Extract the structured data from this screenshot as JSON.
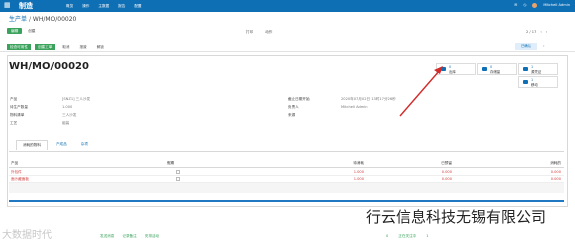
{
  "topbar": {
    "apps_icon": "apps-grid-icon",
    "app_title": "制造",
    "menu": [
      "概览",
      "操作",
      "主数据",
      "报告",
      "配置"
    ],
    "right": {
      "user": "Mitchell Admin"
    }
  },
  "breadcrumb": {
    "root": "生产单",
    "sep": "/",
    "current": "WH/MO/00020"
  },
  "control": {
    "edit": "编辑",
    "create": "创建",
    "print": "打印",
    "action": "动作",
    "pager": "2 / 17"
  },
  "actions": {
    "check_availability": "检查可用性",
    "create_workorder": "创建工单",
    "cancel": "取消",
    "scrap": "报废",
    "unreserve": "解锁"
  },
  "steps": [
    "已确认"
  ],
  "record": {
    "title": "WH/MO/00020"
  },
  "smart_buttons": [
    {
      "num": "0",
      "label": "出库",
      "icon": "truck-icon"
    },
    {
      "num": "0",
      "label": "存储量",
      "icon": "cart-icon"
    },
    {
      "num": "1",
      "label": "源凭证",
      "icon": "truck-icon"
    },
    {
      "num": "1",
      "label": "移动",
      "icon": "truck-icon"
    }
  ],
  "left_fields": [
    {
      "label": "产品",
      "value": "[SNZ1] 三人沙发"
    },
    {
      "label": "待生产数量",
      "value": "1.000"
    },
    {
      "label": "物料清单",
      "value": "三人沙发"
    },
    {
      "label": "工艺",
      "value": "组装"
    }
  ],
  "right_fields": [
    {
      "label": "截止日期开始",
      "value": "2020年07月02日 13时17分26秒"
    },
    {
      "label": "负责人",
      "value": "Mitchell Admin"
    },
    {
      "label": "来源",
      "value": ""
    }
  ],
  "tabs": [
    "消耗的物料",
    "产成品",
    "杂项"
  ],
  "table": {
    "headers": [
      "产品",
      "假期",
      "待消耗",
      "已预留",
      "消耗的"
    ],
    "rows": [
      {
        "product": "外包件",
        "c1": "1.000",
        "c2": "0.000",
        "c3": "0.000"
      },
      {
        "product": "面沙藏面板",
        "c1": "1.000",
        "c2": "0.000",
        "c3": "0.000"
      }
    ]
  },
  "chatter": [
    "发送消息",
    "记录备注",
    "安排活动"
  ],
  "followers": [
    "0",
    "正在关注中",
    "1"
  ],
  "watermark": "行云信息科技无锡有限公司",
  "watermark_left": "大数据时代"
}
